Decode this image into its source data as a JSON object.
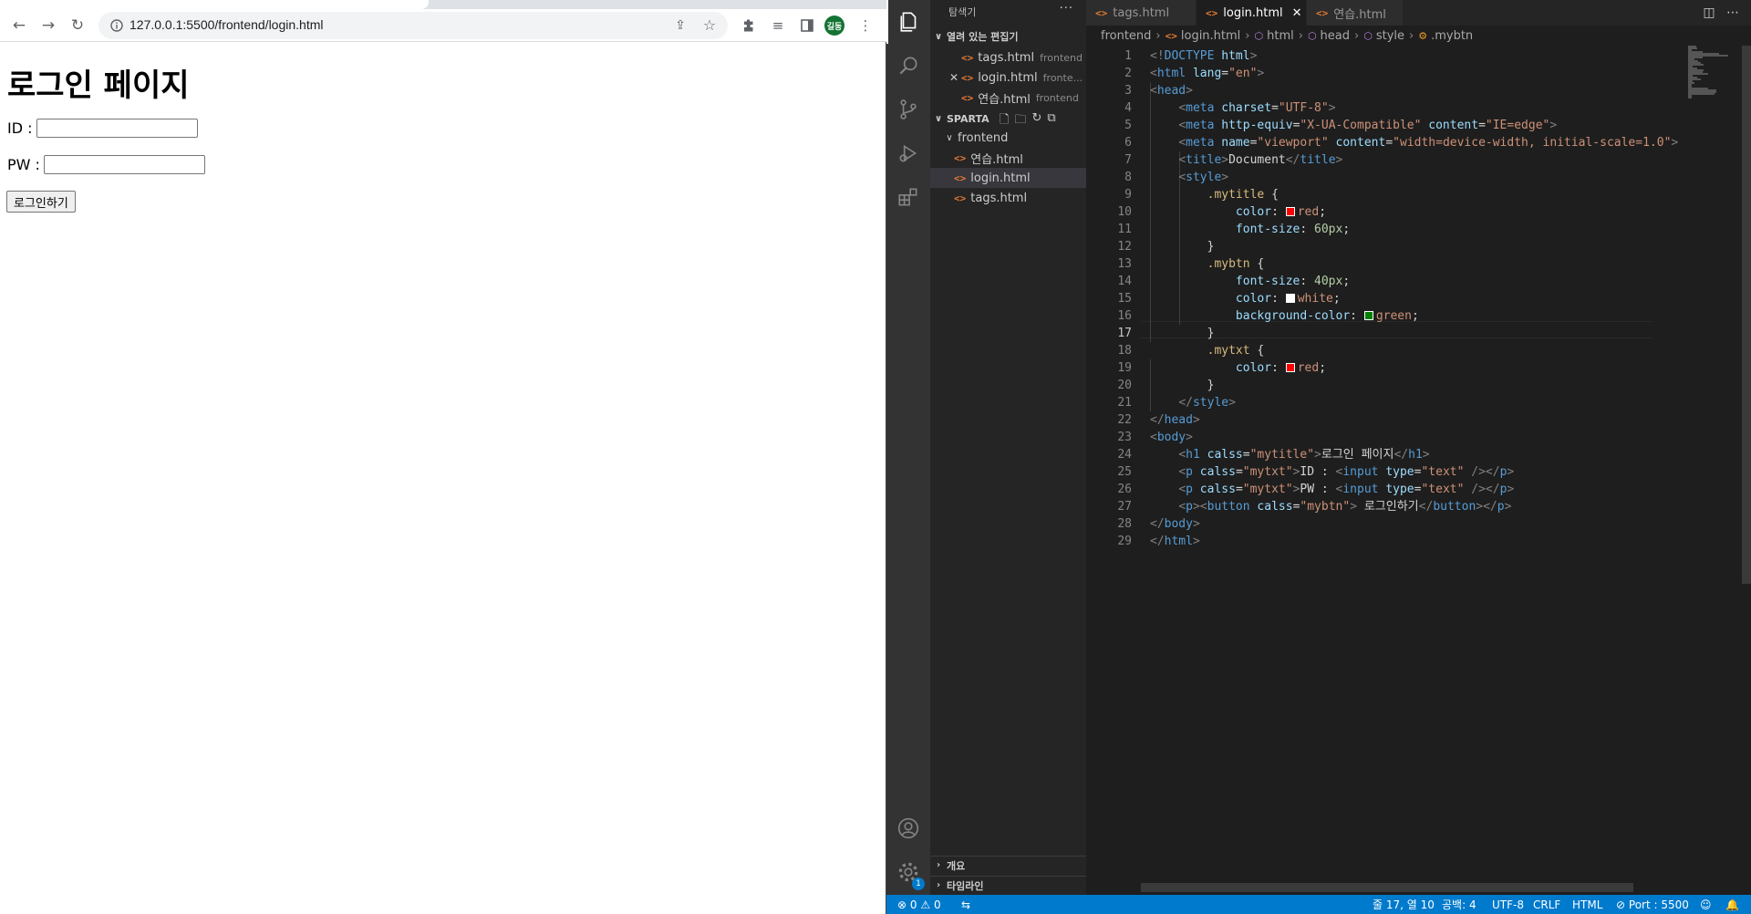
{
  "browser": {
    "url": "127.0.0.1:5500/frontend/login.html",
    "profile_initial": "길동",
    "page": {
      "heading": "로그인 페이지",
      "id_label": "ID :",
      "pw_label": "PW :",
      "id_value": "",
      "pw_value": "",
      "login_button": "로그인하기"
    }
  },
  "vscode": {
    "explorer_title": "탐색기",
    "more": "···",
    "open_editors_title": "열려 있는 편집기",
    "open_editors": [
      {
        "name": "tags.html",
        "desc": "frontend"
      },
      {
        "name": "login.html",
        "desc": "fronte..."
      },
      {
        "name": "연습.html",
        "desc": "frontend"
      }
    ],
    "workspace_title": "SPARTA",
    "folder": "frontend",
    "files": [
      "연습.html",
      "login.html",
      "tags.html"
    ],
    "outline_title": "개요",
    "timeline_title": "타임라인",
    "tabs": [
      "tags.html",
      "login.html",
      "연습.html"
    ],
    "breadcrumb": [
      "frontend",
      "login.html",
      "html",
      "head",
      "style",
      ".mybtn"
    ],
    "line_numbers": [
      "1",
      "2",
      "3",
      "4",
      "5",
      "6",
      "7",
      "8",
      "9",
      "10",
      "11",
      "12",
      "13",
      "14",
      "15",
      "16",
      "17",
      "18",
      "19",
      "20",
      "21",
      "22",
      "23",
      "24",
      "25",
      "26",
      "27",
      "28",
      "29"
    ],
    "code": [
      [
        [
          "p",
          "<!"
        ],
        [
          "t",
          "DOCTYPE"
        ],
        [
          "txt",
          " "
        ],
        [
          "a",
          "html"
        ],
        [
          "p",
          ">"
        ]
      ],
      [
        [
          "p",
          "<"
        ],
        [
          "t",
          "html"
        ],
        [
          "txt",
          " "
        ],
        [
          "a",
          "lang"
        ],
        [
          "txt",
          "="
        ],
        [
          "s",
          "\"en\""
        ],
        [
          "p",
          ">"
        ]
      ],
      [
        [
          "p",
          "<"
        ],
        [
          "t",
          "head"
        ],
        [
          "p",
          ">"
        ]
      ],
      [
        [
          "txt",
          "    "
        ],
        [
          "p",
          "<"
        ],
        [
          "t",
          "meta"
        ],
        [
          "txt",
          " "
        ],
        [
          "a",
          "charset"
        ],
        [
          "txt",
          "="
        ],
        [
          "s",
          "\"UTF-8\""
        ],
        [
          "p",
          ">"
        ]
      ],
      [
        [
          "txt",
          "    "
        ],
        [
          "p",
          "<"
        ],
        [
          "t",
          "meta"
        ],
        [
          "txt",
          " "
        ],
        [
          "a",
          "http-equiv"
        ],
        [
          "txt",
          "="
        ],
        [
          "s",
          "\"X-UA-Compatible\""
        ],
        [
          "txt",
          " "
        ],
        [
          "a",
          "content"
        ],
        [
          "txt",
          "="
        ],
        [
          "s",
          "\"IE=edge\""
        ],
        [
          "p",
          ">"
        ]
      ],
      [
        [
          "txt",
          "    "
        ],
        [
          "p",
          "<"
        ],
        [
          "t",
          "meta"
        ],
        [
          "txt",
          " "
        ],
        [
          "a",
          "name"
        ],
        [
          "txt",
          "="
        ],
        [
          "s",
          "\"viewport\""
        ],
        [
          "txt",
          " "
        ],
        [
          "a",
          "content"
        ],
        [
          "txt",
          "="
        ],
        [
          "s",
          "\"width=device-width, initial-scale=1.0\""
        ],
        [
          "p",
          ">"
        ]
      ],
      [
        [
          "txt",
          "    "
        ],
        [
          "p",
          "<"
        ],
        [
          "t",
          "title"
        ],
        [
          "p",
          ">"
        ],
        [
          "txt",
          "Document"
        ],
        [
          "p",
          "</"
        ],
        [
          "t",
          "title"
        ],
        [
          "p",
          ">"
        ]
      ],
      [
        [
          "txt",
          "    "
        ],
        [
          "p",
          "<"
        ],
        [
          "t",
          "style"
        ],
        [
          "p",
          ">"
        ]
      ],
      [
        [
          "txt",
          "        "
        ],
        [
          "c",
          ".mytitle"
        ],
        [
          "txt",
          " {"
        ]
      ],
      [
        [
          "txt",
          "            "
        ],
        [
          "a",
          "color"
        ],
        [
          "txt",
          ": "
        ],
        [
          "sw",
          "#ff0000"
        ],
        [
          "s",
          "red"
        ],
        [
          "txt",
          ";"
        ]
      ],
      [
        [
          "txt",
          "            "
        ],
        [
          "a",
          "font-size"
        ],
        [
          "txt",
          ": "
        ],
        [
          "v",
          "60px"
        ],
        [
          "txt",
          ";"
        ]
      ],
      [
        [
          "txt",
          "        }"
        ]
      ],
      [
        [
          "txt",
          "        "
        ],
        [
          "c",
          ".mybtn"
        ],
        [
          "txt",
          " {"
        ]
      ],
      [
        [
          "txt",
          "            "
        ],
        [
          "a",
          "font-size"
        ],
        [
          "txt",
          ": "
        ],
        [
          "v",
          "40px"
        ],
        [
          "txt",
          ";"
        ]
      ],
      [
        [
          "txt",
          "            "
        ],
        [
          "a",
          "color"
        ],
        [
          "txt",
          ": "
        ],
        [
          "sw",
          "#ffffff"
        ],
        [
          "s",
          "white"
        ],
        [
          "txt",
          ";"
        ]
      ],
      [
        [
          "txt",
          "            "
        ],
        [
          "a",
          "background-color"
        ],
        [
          "txt",
          ": "
        ],
        [
          "sw",
          "#008000"
        ],
        [
          "s",
          "green"
        ],
        [
          "txt",
          ";"
        ]
      ],
      [
        [
          "txt",
          "        }"
        ]
      ],
      [
        [
          "txt",
          "        "
        ],
        [
          "c",
          ".mytxt"
        ],
        [
          "txt",
          " {"
        ]
      ],
      [
        [
          "txt",
          "            "
        ],
        [
          "a",
          "color"
        ],
        [
          "txt",
          ": "
        ],
        [
          "sw",
          "#ff0000"
        ],
        [
          "s",
          "red"
        ],
        [
          "txt",
          ";"
        ]
      ],
      [
        [
          "txt",
          "        }"
        ]
      ],
      [
        [
          "txt",
          "    "
        ],
        [
          "p",
          "</"
        ],
        [
          "t",
          "style"
        ],
        [
          "p",
          ">"
        ]
      ],
      [
        [
          "p",
          "</"
        ],
        [
          "t",
          "head"
        ],
        [
          "p",
          ">"
        ]
      ],
      [
        [
          "p",
          "<"
        ],
        [
          "t",
          "body"
        ],
        [
          "p",
          ">"
        ]
      ],
      [
        [
          "txt",
          "    "
        ],
        [
          "p",
          "<"
        ],
        [
          "t",
          "h1"
        ],
        [
          "txt",
          " "
        ],
        [
          "a",
          "calss"
        ],
        [
          "txt",
          "="
        ],
        [
          "s",
          "\"mytitle\""
        ],
        [
          "p",
          ">"
        ],
        [
          "txt",
          "로그인 페이지"
        ],
        [
          "p",
          "</"
        ],
        [
          "t",
          "h1"
        ],
        [
          "p",
          ">"
        ]
      ],
      [
        [
          "txt",
          "    "
        ],
        [
          "p",
          "<"
        ],
        [
          "t",
          "p"
        ],
        [
          "txt",
          " "
        ],
        [
          "a",
          "calss"
        ],
        [
          "txt",
          "="
        ],
        [
          "s",
          "\"mytxt\""
        ],
        [
          "p",
          ">"
        ],
        [
          "txt",
          "ID : "
        ],
        [
          "p",
          "<"
        ],
        [
          "t",
          "input"
        ],
        [
          "txt",
          " "
        ],
        [
          "a",
          "type"
        ],
        [
          "txt",
          "="
        ],
        [
          "s",
          "\"text\""
        ],
        [
          "txt",
          " "
        ],
        [
          "p",
          "/></"
        ],
        [
          "t",
          "p"
        ],
        [
          "p",
          ">"
        ]
      ],
      [
        [
          "txt",
          "    "
        ],
        [
          "p",
          "<"
        ],
        [
          "t",
          "p"
        ],
        [
          "txt",
          " "
        ],
        [
          "a",
          "calss"
        ],
        [
          "txt",
          "="
        ],
        [
          "s",
          "\"mytxt\""
        ],
        [
          "p",
          ">"
        ],
        [
          "txt",
          "PW : "
        ],
        [
          "p",
          "<"
        ],
        [
          "t",
          "input"
        ],
        [
          "txt",
          " "
        ],
        [
          "a",
          "type"
        ],
        [
          "txt",
          "="
        ],
        [
          "s",
          "\"text\""
        ],
        [
          "txt",
          " "
        ],
        [
          "p",
          "/></"
        ],
        [
          "t",
          "p"
        ],
        [
          "p",
          ">"
        ]
      ],
      [
        [
          "txt",
          "    "
        ],
        [
          "p",
          "<"
        ],
        [
          "t",
          "p"
        ],
        [
          "p",
          "><"
        ],
        [
          "t",
          "button"
        ],
        [
          "txt",
          " "
        ],
        [
          "a",
          "calss"
        ],
        [
          "txt",
          "="
        ],
        [
          "s",
          "\"mybtn\""
        ],
        [
          "p",
          ">"
        ],
        [
          "txt",
          " 로그인하기"
        ],
        [
          "p",
          "</"
        ],
        [
          "t",
          "button"
        ],
        [
          "p",
          "></"
        ],
        [
          "t",
          "p"
        ],
        [
          "p",
          ">"
        ]
      ],
      [
        [
          "p",
          "</"
        ],
        [
          "t",
          "body"
        ],
        [
          "p",
          ">"
        ]
      ],
      [
        [
          "p",
          "</"
        ],
        [
          "t",
          "html"
        ],
        [
          "p",
          ">"
        ]
      ]
    ],
    "status": {
      "errors": "0",
      "warnings": "0",
      "position": "줄 17, 열 10",
      "spaces": "공백: 4",
      "encoding": "UTF-8",
      "eol": "CRLF",
      "language": "HTML",
      "port": "Port : 5500",
      "badge": "1"
    }
  }
}
